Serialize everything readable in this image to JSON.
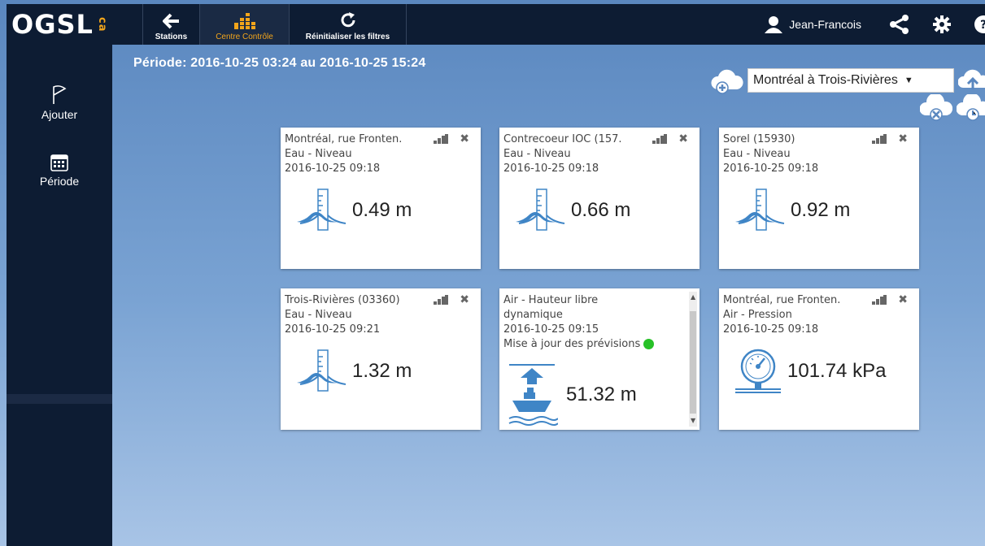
{
  "app": {
    "logo": "OGSL",
    "logo_suffix": "ca"
  },
  "topbar": {
    "stations_label": "Stations",
    "centre_label": "Centre Contrôle",
    "reset_label": "Réinitialiser les filtres",
    "user_name": "Jean-Francois"
  },
  "sidebar": {
    "ajouter_label": "Ajouter",
    "periode_label": "Période"
  },
  "header": {
    "periode_text": "Période: 2016-10-25 03:24 au 2016-10-25 15:24",
    "route_selected": "Montréal à Trois-Rivières"
  },
  "cards": [
    {
      "title": "Montréal, rue Fronten.",
      "type": "Eau - Niveau",
      "date": "2016-10-25 09:18",
      "value": "0.49 m"
    },
    {
      "title": "Contrecoeur IOC (157.",
      "type": "Eau - Niveau",
      "date": "2016-10-25 09:18",
      "value": "0.66 m"
    },
    {
      "title": "Sorel (15930)",
      "type": "Eau - Niveau",
      "date": "2016-10-25 09:18",
      "value": "0.92 m"
    },
    {
      "title": "Trois-Rivières (03360)",
      "type": "Eau - Niveau",
      "date": "2016-10-25 09:21",
      "value": "1.32 m"
    },
    {
      "type_line1": "Air - Hauteur libre",
      "type_line2": "dynamique",
      "date": "2016-10-25 09:15",
      "status": "Mise à jour des prévisions",
      "value": "51.32 m"
    },
    {
      "title": "Montréal, rue Fronten.",
      "type": "Air - Pression",
      "date": "2016-10-25 09:18",
      "value": "101.74 kPa"
    }
  ],
  "colors": {
    "accent": "#f3a51b",
    "navy": "#0d1c33",
    "status_ok": "#27c127",
    "icon_blue": "#3f85c6"
  }
}
